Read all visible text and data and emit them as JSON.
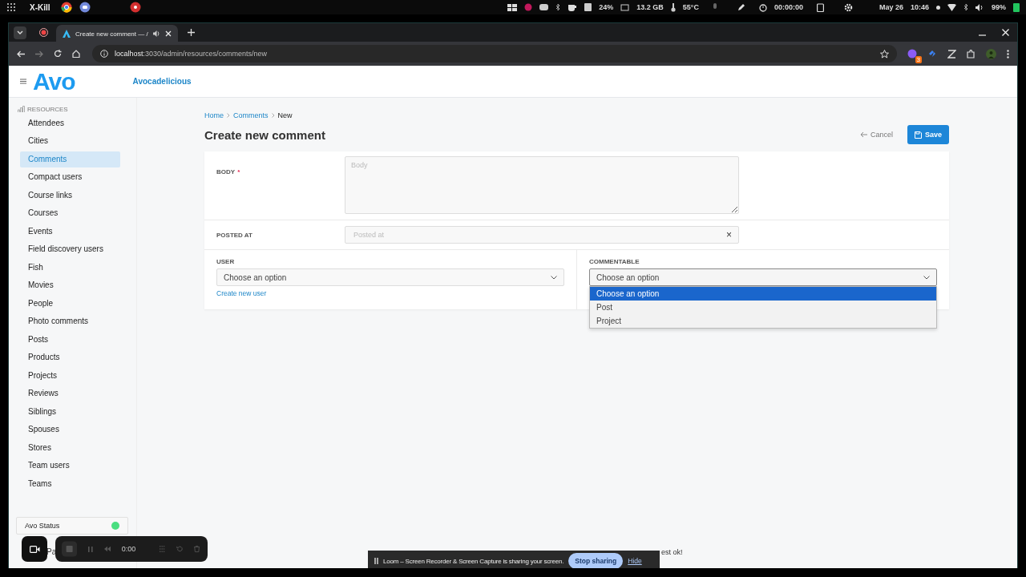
{
  "system_bar": {
    "workspace": "X-Kill",
    "stats": [
      "24%",
      "13.2 GB",
      "55°C"
    ],
    "timer": "00:00:00",
    "date": "May 26",
    "time": "10:46",
    "battery": "99%"
  },
  "browser": {
    "tab_title": "Create new comment — /",
    "url_host": "localhost",
    "url_path": ":3030/admin/resources/comments/new",
    "extension_badge": "3"
  },
  "header": {
    "brand": "Avo",
    "app_name": "Avocadelicious"
  },
  "sidebar": {
    "heading": "RESOURCES",
    "items": [
      {
        "label": "Attendees",
        "selected": false
      },
      {
        "label": "Cities",
        "selected": false
      },
      {
        "label": "Comments",
        "selected": true
      },
      {
        "label": "Compact users",
        "selected": false
      },
      {
        "label": "Course links",
        "selected": false
      },
      {
        "label": "Courses",
        "selected": false
      },
      {
        "label": "Events",
        "selected": false
      },
      {
        "label": "Field discovery users",
        "selected": false
      },
      {
        "label": "Fish",
        "selected": false
      },
      {
        "label": "Movies",
        "selected": false
      },
      {
        "label": "People",
        "selected": false
      },
      {
        "label": "Photo comments",
        "selected": false
      },
      {
        "label": "Posts",
        "selected": false
      },
      {
        "label": "Products",
        "selected": false
      },
      {
        "label": "Projects",
        "selected": false
      },
      {
        "label": "Reviews",
        "selected": false
      },
      {
        "label": "Siblings",
        "selected": false
      },
      {
        "label": "Spouses",
        "selected": false
      },
      {
        "label": "Stores",
        "selected": false
      },
      {
        "label": "Team users",
        "selected": false
      },
      {
        "label": "Teams",
        "selected": false
      }
    ],
    "status": {
      "label": "Avo Status",
      "color": "#4ade80"
    },
    "user_partial": "Pa"
  },
  "breadcrumbs": [
    "Home",
    "Comments",
    "New"
  ],
  "title": "Create new comment",
  "actions": {
    "cancel": "Cancel",
    "save": "Save"
  },
  "form": {
    "body": {
      "label": "BODY",
      "required_mark": "*",
      "placeholder": "Body"
    },
    "posted_at": {
      "label": "POSTED AT",
      "placeholder": "Posted at",
      "clear": "×"
    },
    "user": {
      "label": "USER",
      "value": "Choose an option",
      "link": "Create new user"
    },
    "commentable": {
      "label": "COMMENTABLE",
      "value": "Choose an option",
      "options": [
        {
          "label": "Choose an option",
          "selected": true
        },
        {
          "label": "Post",
          "selected": false
        },
        {
          "label": "Project",
          "selected": false
        }
      ]
    }
  },
  "recorder": {
    "time": "0:00"
  },
  "loom": {
    "message": "Loom – Screen Recorder & Screen Capture is sharing your screen.",
    "stop": "Stop sharing",
    "hide": "Hide"
  },
  "partial_text": "est ok!"
}
